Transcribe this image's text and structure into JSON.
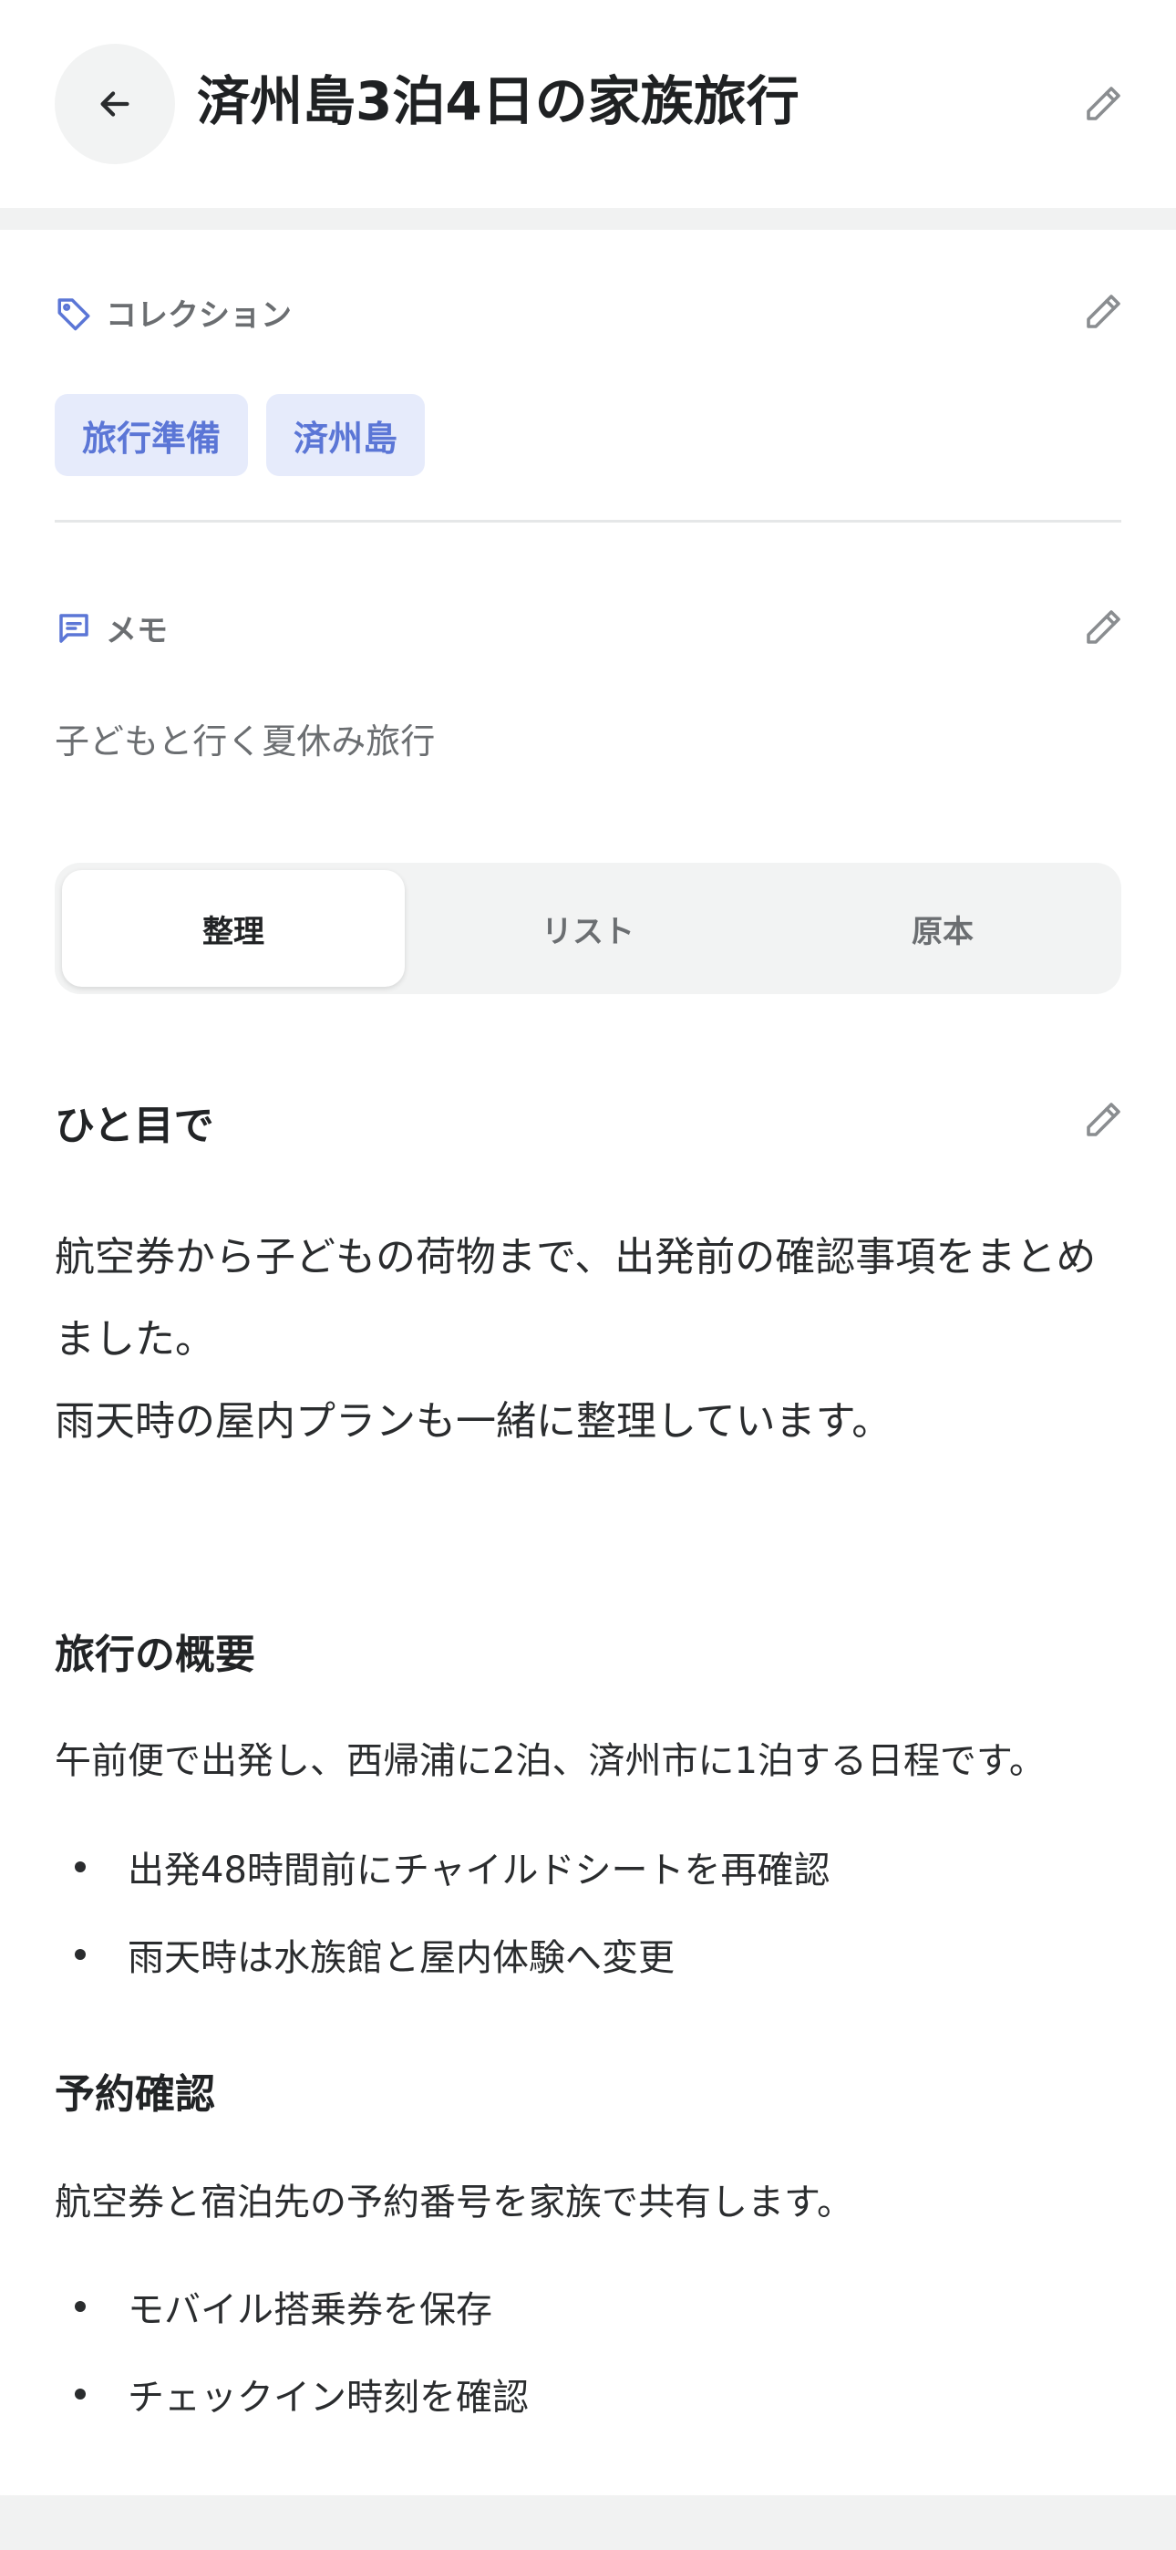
{
  "header": {
    "title": "済州島3泊4日の家族旅行",
    "back_icon": "arrow-left-icon",
    "edit_icon": "pencil-icon"
  },
  "collection": {
    "label": "コレクション",
    "icon": "tag-icon",
    "tags": [
      "旅行準備",
      "済州島"
    ]
  },
  "memo": {
    "label": "メモ",
    "icon": "message-icon",
    "text": "子どもと行く夏休み旅行"
  },
  "tabs": [
    {
      "label": "整理",
      "active": true
    },
    {
      "label": "リスト",
      "active": false
    },
    {
      "label": "原本",
      "active": false
    }
  ],
  "summary": {
    "heading": "ひと目で",
    "line1": "航空券から子どもの荷物まで、出発前の確認事項をまとめ",
    "line2": "ました。",
    "line3": "雨天時の屋内プランも一緒に整理しています。"
  },
  "overview": {
    "heading": "旅行の概要",
    "text": "午前便で出発し、西帰浦に2泊、済州市に1泊する日程です。",
    "bullets": [
      "出発48時間前にチャイルドシートを再確認",
      "雨天時は水族館と屋内体験へ変更"
    ]
  },
  "reservation": {
    "heading": "予約確認",
    "text": "航空券と宿泊先の予約番号を家族で共有します。",
    "bullets": [
      "モバイル搭乗券を保存",
      "チェックイン時刻を確認"
    ]
  },
  "colors": {
    "accent": "#5b76d6",
    "tag_bg": "#e6ebfb",
    "muted": "#6b6e71"
  }
}
